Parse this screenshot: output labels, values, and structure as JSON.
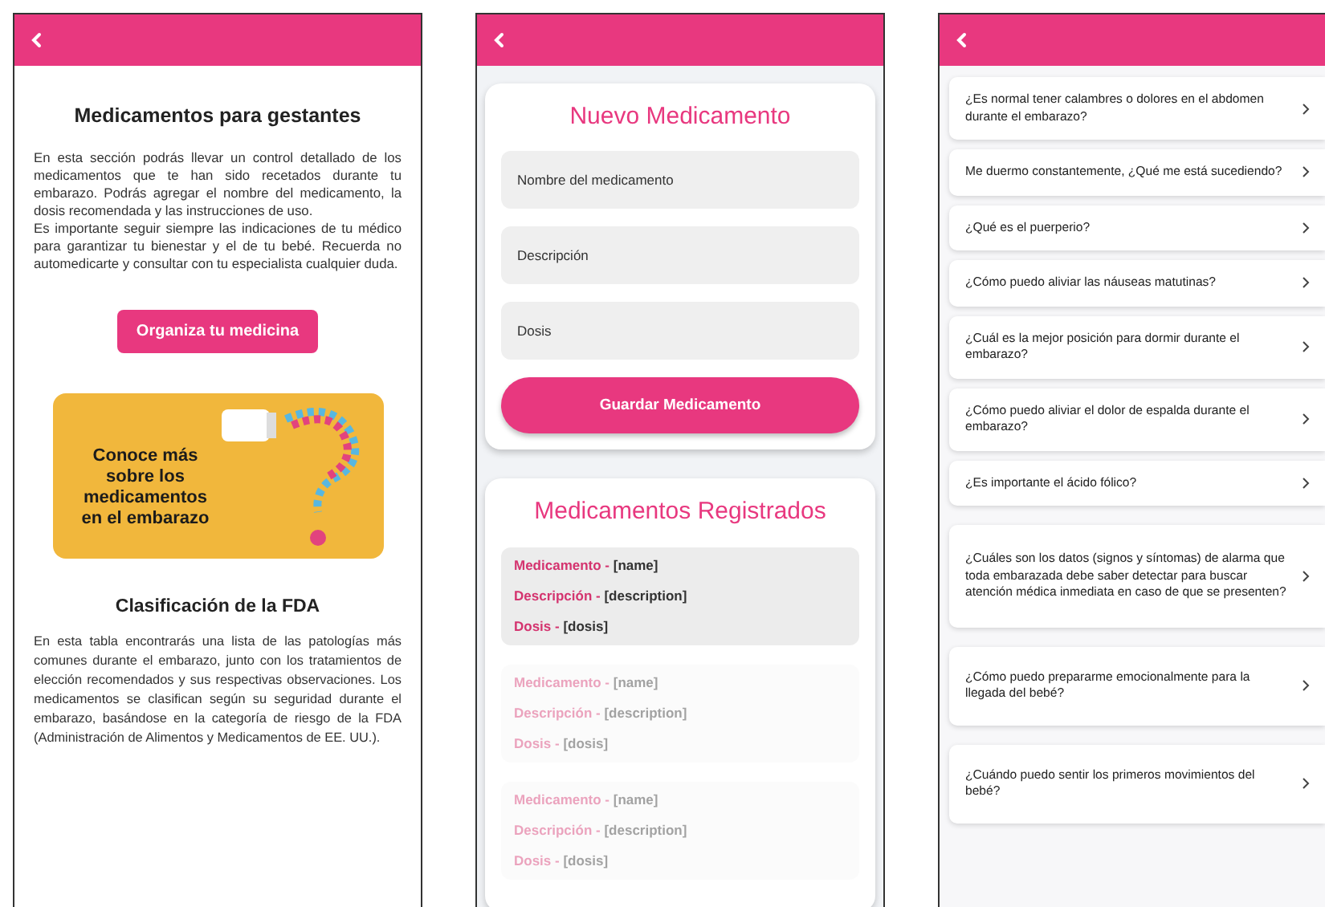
{
  "info_screen": {
    "title": "Medicamentos para gestantes",
    "paragraphs": [
      "En esta sección podrás llevar un control detallado de los medicamentos que te han sido recetados durante tu embarazo. Podrás agregar el nombre del medicamento, la dosis recomendada y las instrucciones de uso.",
      "Es importante seguir siempre las indicaciones de tu médico para garantizar tu bienestar y el de tu bebé. Recuerda no automedicarte y consultar con tu especialista cualquier duda."
    ],
    "button": "Organiza tu medicina",
    "banner": "Conoce más sobre los medicamentos en el embarazo",
    "fda_title": "Clasificación de la FDA",
    "fda_text": "En esta tabla encontrarás una lista de las patologías más comunes durante el embarazo, junto con los tratamientos de elección recomendados y sus respectivas observaciones. Los medicamentos se clasifican según su seguridad durante el embarazo, basándose en la categoría de riesgo de la FDA (Administración de Alimentos y Medicamentos de EE. UU.)."
  },
  "form_screen": {
    "title": "Nuevo Medicamento",
    "fields": [
      {
        "placeholder": "Nombre del medicamento"
      },
      {
        "placeholder": "Descripción"
      },
      {
        "placeholder": "Dosis"
      }
    ],
    "button": "Guardar Medicamento",
    "list_title": "Medicamentos Registrados",
    "records": [
      {
        "selected": true,
        "lines": [
          {
            "label": "Medicamento -",
            "value": "[name]"
          },
          {
            "label": "Descripción -",
            "value": "[description]"
          },
          {
            "label": "Dosis -",
            "value": "[dosis]"
          }
        ]
      },
      {
        "selected": false,
        "lines": [
          {
            "label": "Medicamento -",
            "value": "[name]"
          },
          {
            "label": "Descripción -",
            "value": "[description]"
          },
          {
            "label": "Dosis -",
            "value": "[dosis]"
          }
        ]
      },
      {
        "selected": false,
        "lines": [
          {
            "label": "Medicamento -",
            "value": "[name]"
          },
          {
            "label": "Descripción -",
            "value": "[description]"
          },
          {
            "label": "Dosis -",
            "value": "[dosis]"
          }
        ]
      }
    ]
  },
  "faq_screen": {
    "questions": [
      "¿Es normal tener calambres o dolores en el abdomen durante el embarazo?",
      "Me duermo constantemente, ¿Qué me está sucediendo?",
      "¿Qué es el puerperio?",
      "¿Cómo puedo aliviar las náuseas matutinas?",
      "¿Cuál es la mejor posición para dormir durante el embarazo?",
      "¿Cómo puedo aliviar el dolor de espalda durante el embarazo?",
      "¿Es importante el ácido fólico?",
      "¿Cuáles son los datos (signos y síntomas) de alarma que toda embarazada debe saber detectar para buscar atención médica inmediata en caso de que se presenten?",
      "¿Cómo puedo prepararme emocionalmente para la llegada del bebé?",
      "¿Cuándo puedo sentir los primeros movimientos del bebé?"
    ]
  }
}
